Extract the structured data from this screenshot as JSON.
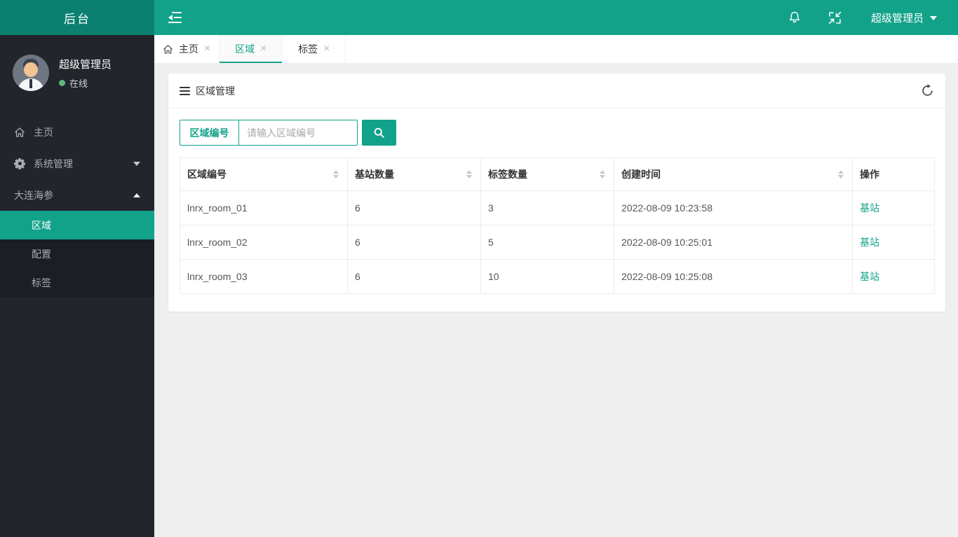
{
  "topbar": {
    "logo_text": "后台",
    "username": "超级管理员"
  },
  "tabs": [
    {
      "label": "主页",
      "active": false,
      "closable": true
    },
    {
      "label": "区域",
      "active": true,
      "closable": true
    },
    {
      "label": "标签",
      "active": false,
      "closable": true
    }
  ],
  "sidebar": {
    "user": {
      "name": "超级管理员",
      "status": "在线"
    },
    "items": [
      {
        "label": "主页",
        "icon": "home"
      },
      {
        "label": "系统管理",
        "icon": "gear",
        "caret": "down"
      },
      {
        "label": "大连海参",
        "caret": "up"
      }
    ],
    "submenu": [
      {
        "label": "区域",
        "active": true
      },
      {
        "label": "配置",
        "active": false
      },
      {
        "label": "标签",
        "active": false
      }
    ]
  },
  "panel": {
    "title": "区域管理",
    "search": {
      "field_label": "区域编号",
      "placeholder": "请输入区域编号",
      "value": ""
    },
    "table": {
      "columns": [
        {
          "label": "区域编号",
          "sortable": true
        },
        {
          "label": "基站数量",
          "sortable": true
        },
        {
          "label": "标签数量",
          "sortable": true
        },
        {
          "label": "创建时间",
          "sortable": true
        },
        {
          "label": "操作",
          "sortable": false
        }
      ],
      "rows": [
        {
          "area_id": "lnrx_room_01",
          "station_count": "6",
          "tag_count": "3",
          "created_at": "2022-08-09 10:23:58",
          "action_label": "基站"
        },
        {
          "area_id": "lnrx_room_02",
          "station_count": "6",
          "tag_count": "5",
          "created_at": "2022-08-09 10:25:01",
          "action_label": "基站"
        },
        {
          "area_id": "lnrx_room_03",
          "station_count": "6",
          "tag_count": "10",
          "created_at": "2022-08-09 10:25:08",
          "action_label": "基站"
        }
      ]
    }
  },
  "colors": {
    "accent_teal": "#12a28a",
    "logo_teal_dark": "#0c8070",
    "sidebar_bg": "#22252c",
    "submenu_bg": "#1b1e25",
    "online_green": "#5fb878",
    "content_bg": "#efefef",
    "link_teal": "#12a28a"
  }
}
